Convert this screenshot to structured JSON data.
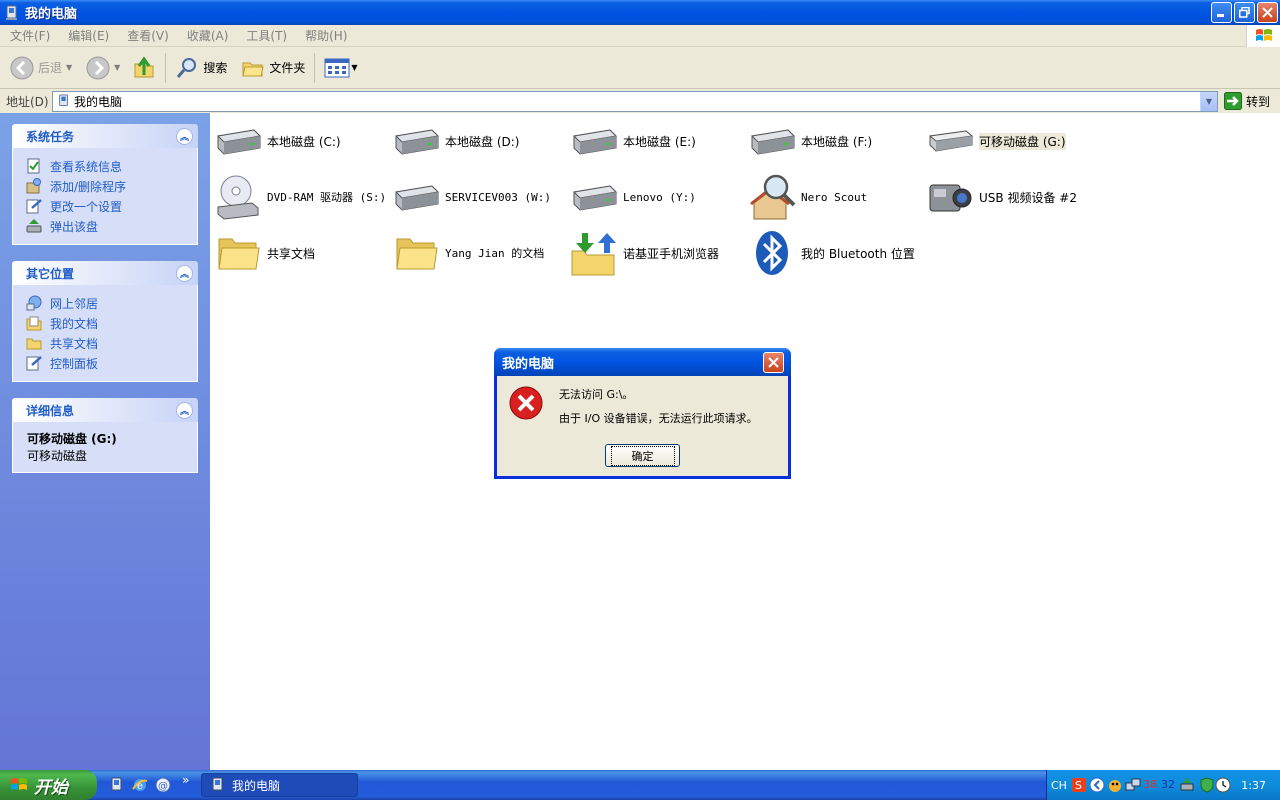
{
  "window": {
    "title": "我的电脑"
  },
  "menu": [
    "文件(F)",
    "编辑(E)",
    "查看(V)",
    "收藏(A)",
    "工具(T)",
    "帮助(H)"
  ],
  "toolbar": {
    "back": "后退",
    "search": "搜索",
    "folders": "文件夹"
  },
  "address": {
    "label": "地址(D)",
    "value": "我的电脑",
    "go": "转到"
  },
  "taskpane": {
    "system_tasks": {
      "title": "系统任务",
      "links": [
        "查看系统信息",
        "添加/删除程序",
        "更改一个设置",
        "弹出该盘"
      ]
    },
    "other_places": {
      "title": "其它位置",
      "links": [
        "网上邻居",
        "我的文档",
        "共享文档",
        "控制面板"
      ]
    },
    "details": {
      "title": "详细信息",
      "name": "可移动磁盘 (G:)",
      "type": "可移动磁盘"
    }
  },
  "items": [
    "本地磁盘 (C:)",
    "本地磁盘 (D:)",
    "本地磁盘 (E:)",
    "本地磁盘 (F:)",
    "可移动磁盘 (G:)",
    "DVD-RAM 驱动器 (S:)",
    "SERVICEV003 (W:)",
    "Lenovo (Y:)",
    "Nero Scout",
    "USB 视频设备 #2",
    "共享文档",
    "Yang Jian 的文档",
    "诺基亚手机浏览器",
    "我的 Bluetooth 位置"
  ],
  "dialog": {
    "title": "我的电脑",
    "line1": "无法访问 G:\\。",
    "line2": "由于 I/O 设备错误，无法运行此项请求。",
    "ok": "确定"
  },
  "taskbar": {
    "start": "开始",
    "task": "我的电脑",
    "lang": "CH",
    "tray_nums": [
      "38",
      "32"
    ],
    "clock": "1:37"
  }
}
